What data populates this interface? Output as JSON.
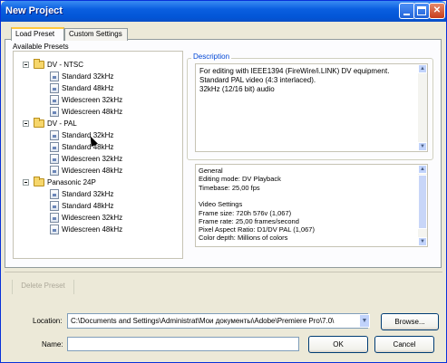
{
  "window": {
    "title": "New Project",
    "minimize_label": "",
    "maximize_label": "",
    "close_label": "✕"
  },
  "tabs": [
    {
      "label": "Load Preset",
      "active": true
    },
    {
      "label": "Custom Settings",
      "active": false
    }
  ],
  "presets": {
    "label": "Available Presets",
    "folders": [
      {
        "label": "DV - NTSC",
        "items": [
          "Standard 32kHz",
          "Standard 48kHz",
          "Widescreen 32kHz",
          "Widescreen 48kHz"
        ]
      },
      {
        "label": "DV - PAL",
        "items": [
          "Standard 32kHz",
          "Standard 48kHz",
          "Widescreen 32kHz",
          "Widescreen 48kHz"
        ]
      },
      {
        "label": "Panasonic 24P",
        "items": [
          "Standard 32kHz",
          "Standard 48kHz",
          "Widescreen 32kHz",
          "Widescreen 48kHz"
        ]
      }
    ]
  },
  "description": {
    "title": "Description",
    "lines": [
      "For editing with IEEE1394 (FireWire/i.LINK) DV equipment.",
      "Standard PAL video (4:3 interlaced).",
      "32kHz (12/16 bit) audio"
    ]
  },
  "info": {
    "lines": [
      "General",
      "Editing mode: DV Playback",
      "Timebase: 25,00 fps",
      "",
      "Video Settings",
      "Frame size: 720h 576v (1,067)",
      "Frame rate: 25,00 frames/second",
      "Pixel Aspect Ratio: D1/DV PAL (1,067)",
      "Color depth: Millions of colors"
    ]
  },
  "actions": {
    "delete_preset": "Delete Preset",
    "browse": "Browse...",
    "ok": "OK",
    "cancel": "Cancel"
  },
  "location": {
    "label": "Location:",
    "value": "C:\\Documents and Settings\\Administrat\\Мои документы\\Adobe\\Premiere Pro\\7.0\\"
  },
  "name": {
    "label": "Name:",
    "value": ""
  }
}
